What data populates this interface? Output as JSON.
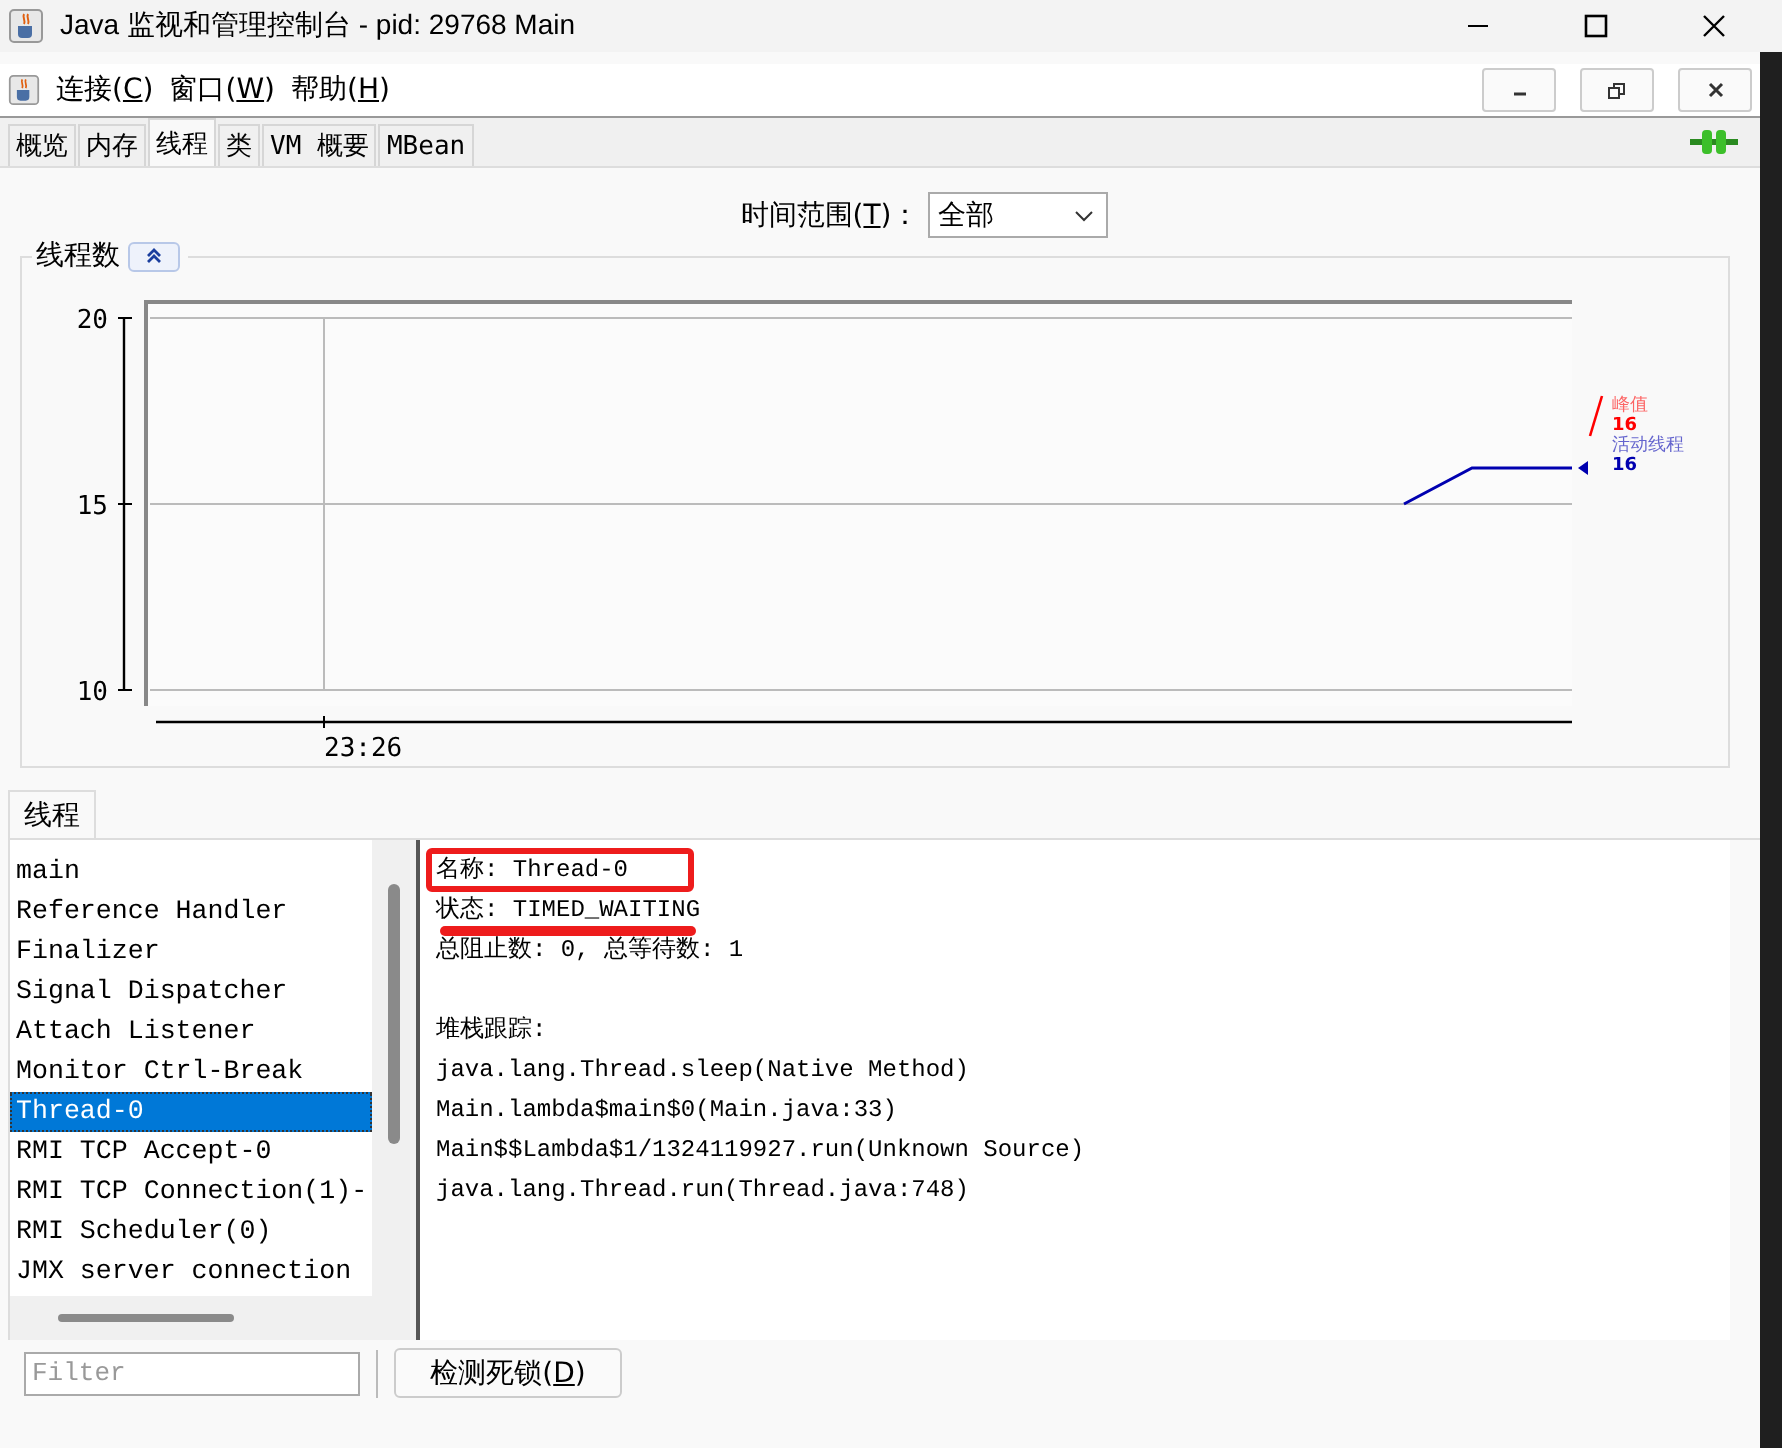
{
  "window": {
    "title": "Java 监视和管理控制台 - pid: 29768 Main"
  },
  "menu": [
    {
      "before": "连接(",
      "key": "C",
      "after": ")"
    },
    {
      "before": "窗口(",
      "key": "W",
      "after": ")"
    },
    {
      "before": "帮助(",
      "key": "H",
      "after": ")"
    }
  ],
  "tabs": [
    {
      "label": "概览",
      "selected": false
    },
    {
      "label": "内存",
      "selected": false
    },
    {
      "label": "线程",
      "selected": true
    },
    {
      "label": "类",
      "selected": false
    },
    {
      "label": "VM 概要",
      "selected": false
    },
    {
      "label": "MBean",
      "selected": false
    }
  ],
  "time_range": {
    "before": "时间范围(",
    "key": "T",
    "after": ")：",
    "value": "全部"
  },
  "chart_panel": {
    "title": "线程数",
    "y_labels": [
      "20",
      "15",
      "10"
    ],
    "x_labels": [
      "23:26"
    ],
    "legend": [
      {
        "label": "峰值",
        "value": "16",
        "color": "#ff0000"
      },
      {
        "label": "活动线程",
        "value": "16",
        "color": "#0000b0"
      }
    ]
  },
  "threads_tab": {
    "label": "线程",
    "selected": true
  },
  "threads": [
    {
      "name": "main",
      "selected": false
    },
    {
      "name": "Reference Handler",
      "selected": false
    },
    {
      "name": "Finalizer",
      "selected": false
    },
    {
      "name": "Signal Dispatcher",
      "selected": false
    },
    {
      "name": "Attach Listener",
      "selected": false
    },
    {
      "name": "Monitor Ctrl-Break",
      "selected": false
    },
    {
      "name": "Thread-0",
      "selected": true
    },
    {
      "name": "RMI TCP Accept-0",
      "selected": false
    },
    {
      "name": "RMI TCP Connection(1)-",
      "selected": false
    },
    {
      "name": "RMI Scheduler(0)",
      "selected": false
    },
    {
      "name": "JMX server connection",
      "selected": false
    }
  ],
  "details": {
    "lines": [
      {
        "text": "名称: Thread-0",
        "boxed": true,
        "underlined": false
      },
      {
        "text": "状态: TIMED_WAITING",
        "boxed": false,
        "underlined": true
      },
      {
        "text": "总阻止数: 0, 总等待数: 1",
        "boxed": false,
        "underlined": false
      }
    ],
    "stack_title": "堆栈跟踪:",
    "stack": [
      "java.lang.Thread.sleep(Native Method)",
      "Main.lambda$main$0(Main.java:33)",
      "Main$$Lambda$1/1324119927.run(Unknown Source)",
      "java.lang.Thread.run(Thread.java:748)"
    ]
  },
  "filter": {
    "placeholder": "Filter"
  },
  "deadlock_button": {
    "before": "检测死锁(",
    "key": "D",
    "after": ")"
  }
}
